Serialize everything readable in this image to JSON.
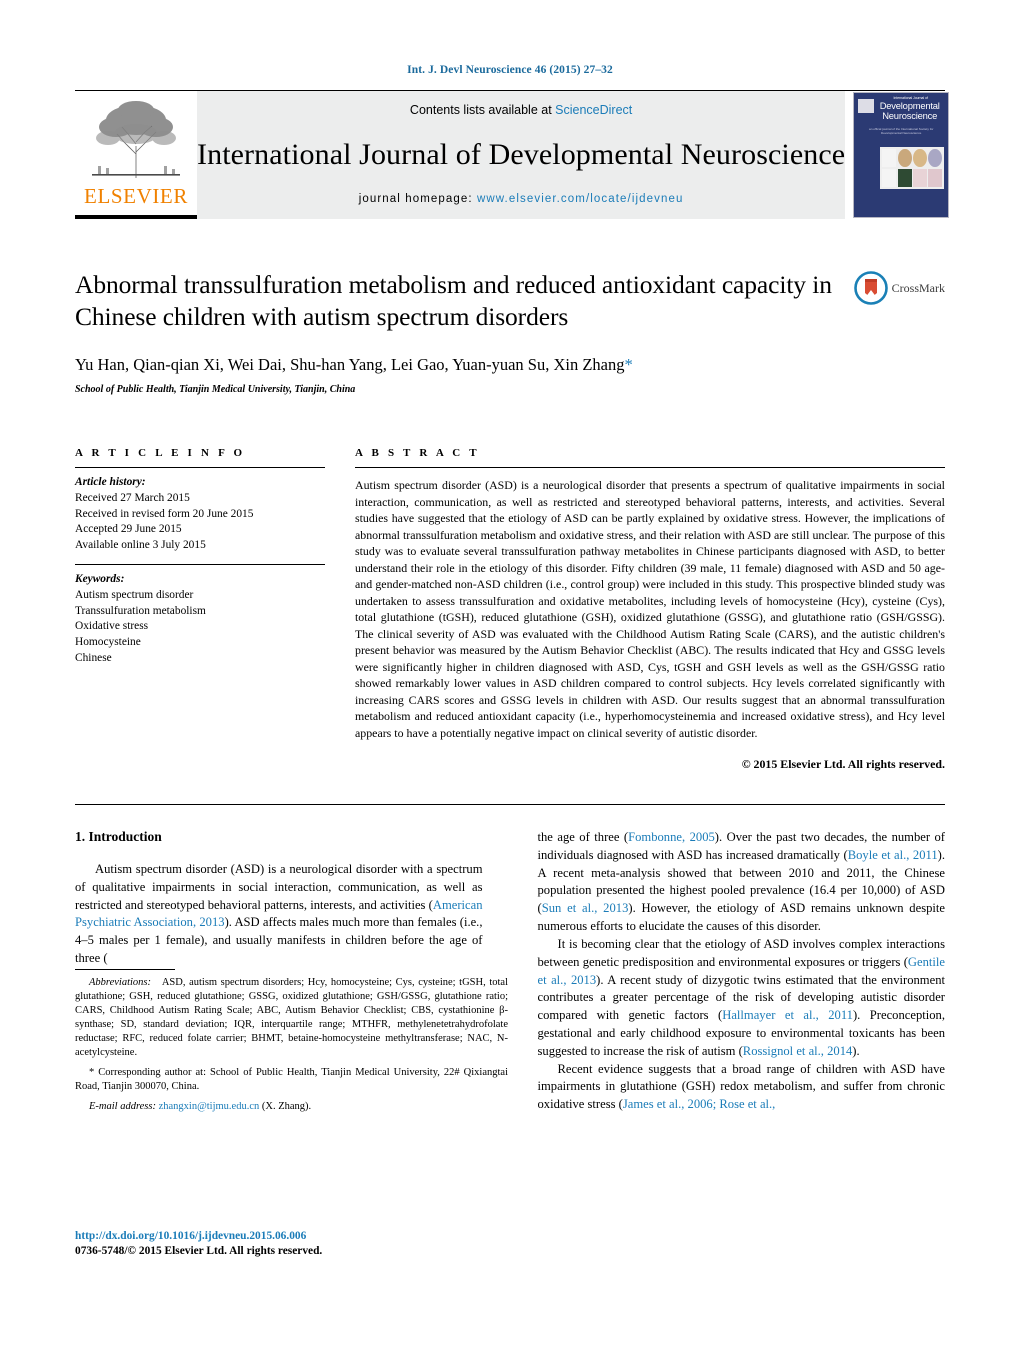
{
  "running_head": "Int. J. Devl Neuroscience 46 (2015) 27–32",
  "masthead": {
    "publisher": "ELSEVIER",
    "contents_prefix": "Contents lists available at ",
    "contents_link": "ScienceDirect",
    "journal_title": "International Journal of Developmental Neuroscience",
    "homepage_prefix": "journal homepage: ",
    "homepage_url": "www.elsevier.com/locate/ijdevneu",
    "cover": {
      "line1": "International Journal of",
      "line2": "Developmental",
      "line3": "Neuroscience",
      "tagline": "an offical journal of the International Society for Developmental Neuroscience"
    }
  },
  "article": {
    "title": "Abnormal transsulfuration metabolism and reduced antioxidant capacity in Chinese children with autism spectrum disorders",
    "authors": "Yu Han, Qian-qian Xi, Wei Dai, Shu-han Yang, Lei Gao, Yuan-yuan Su, Xin Zhang",
    "corresponding_marker": "*",
    "affiliation": "School of Public Health, Tianjin Medical University, Tianjin, China",
    "crossmark_label": "CrossMark"
  },
  "article_info": {
    "heading": "A R T I C L E   I N F O",
    "history_label": "Article history:",
    "history": [
      "Received 27 March 2015",
      "Received in revised form 20 June 2015",
      "Accepted 29 June 2015",
      "Available online 3 July 2015"
    ],
    "keywords_label": "Keywords:",
    "keywords": [
      "Autism spectrum disorder",
      "Transsulfuration metabolism",
      "Oxidative stress",
      "Homocysteine",
      "Chinese"
    ]
  },
  "abstract": {
    "heading": "A B S T R A C T",
    "text": "Autism spectrum disorder (ASD) is a neurological disorder that presents a spectrum of qualitative impairments in social interaction, communication, as well as restricted and stereotyped behavioral patterns, interests, and activities. Several studies have suggested that the etiology of ASD can be partly explained by oxidative stress. However, the implications of abnormal transsulfuration metabolism and oxidative stress, and their relation with ASD are still unclear. The purpose of this study was to evaluate several transsulfuration pathway metabolites in Chinese participants diagnosed with ASD, to better understand their role in the etiology of this disorder. Fifty children (39 male, 11 female) diagnosed with ASD and 50 age- and gender-matched non-ASD children (i.e., control group) were included in this study. This prospective blinded study was undertaken to assess transsulfuration and oxidative metabolites, including levels of homocysteine (Hcy), cysteine (Cys), total glutathione (tGSH), reduced glutathione (GSH), oxidized glutathione (GSSG), and glutathione ratio (GSH/GSSG). The clinical severity of ASD was evaluated with the Childhood Autism Rating Scale (CARS), and the autistic children's present behavior was measured by the Autism Behavior Checklist (ABC). The results indicated that Hcy and GSSG levels were significantly higher in children diagnosed with ASD, Cys, tGSH and GSH levels as well as the GSH/GSSG ratio showed remarkably lower values in ASD children compared to control subjects. Hcy levels correlated significantly with increasing CARS scores and GSSG levels in children with ASD. Our results suggest that an abnormal transsulfuration metabolism and reduced antioxidant capacity (i.e., hyperhomocysteinemia and increased oxidative stress), and Hcy level appears to have a potentially negative impact on clinical severity of autistic disorder.",
    "copyright": "© 2015 Elsevier Ltd. All rights reserved."
  },
  "introduction": {
    "heading": "1.  Introduction",
    "para1_a": "Autism spectrum disorder (ASD) is a neurological disorder with a spectrum of qualitative impairments in social interaction, communication, as well as restricted and stereotyped behavioral patterns, interests, and activities (",
    "para1_ref1": "American Psychiatric Association, 2013",
    "para1_b": "). ASD affects males much more than females (i.e., 4–5 males per 1 female), and usually manifests in children before the age of three (",
    "para1_ref2": "Fombonne, 2005",
    "para1_c": "). Over the past two decades, the number of individuals diagnosed with ASD has increased dramatically (",
    "para1_ref3": "Boyle et al., 2011",
    "para1_d": "). A recent meta-analysis showed that between 2010 and 2011, the Chinese population presented the highest pooled prevalence (16.4 per 10,000) of ASD (",
    "para1_ref4": "Sun et al., 2013",
    "para1_e": "). However, the etiology of ASD remains unknown despite numerous efforts to elucidate the causes of this disorder.",
    "para2_a": "It is becoming clear that the etiology of ASD involves complex interactions between genetic predisposition and environmental exposures or triggers (",
    "para2_ref1": "Gentile et al., 2013",
    "para2_b": "). A recent study of dizygotic twins estimated that the environment contributes a greater percentage of the risk of developing autistic disorder compared with genetic factors (",
    "para2_ref2": "Hallmayer et al., 2011",
    "para2_c": "). Preconception, gestational and early childhood exposure to environmental toxicants has been suggested to increase the risk of autism (",
    "para2_ref3": "Rossignol et al., 2014",
    "para2_d": ").",
    "para3_a": "Recent evidence suggests that a broad range of children with ASD have impairments in glutathione (GSH) redox metabolism, and suffer from chronic oxidative stress (",
    "para3_ref1": "James et al., 2006; Rose et al.,",
    "para3_b": ""
  },
  "footnotes": {
    "abbrev_label": "Abbreviations:",
    "abbrev_text": "ASD, autism spectrum disorders; Hcy, homocysteine; Cys, cysteine; tGSH, total glutathione; GSH, reduced glutathione; GSSG, oxidized glutathione; GSH/GSSG, glutathione ratio; CARS, Childhood Autism Rating Scale; ABC, Autism Behavior Checklist; CBS, cystathionine β-synthase; SD, standard deviation; IQR, interquartile range; MTHFR, methylenetetrahydrofolate reductase; RFC, reduced folate carrier; BHMT, betaine-homocysteine methyltransferase; NAC, N-acetylcysteine.",
    "corresponding_marker": "*",
    "corresponding_text": "Corresponding author at: School of Public Health, Tianjin Medical University, 22# Qixiangtai Road, Tianjin 300070, China.",
    "email_label": "E-mail address:",
    "email_value": "zhangxin@tijmu.edu.cn",
    "email_suffix": "(X. Zhang)."
  },
  "page_footer": {
    "doi": "http://dx.doi.org/10.1016/j.ijdevneu.2015.06.006",
    "issn_line": "0736-5748/© 2015 Elsevier Ltd. All rights reserved."
  },
  "colors": {
    "link": "#1b7cb8",
    "running_head": "#1b6a9c",
    "elsevier_orange": "#f08100",
    "masthead_bg": "#eceded",
    "cover_bg": "#2b3a73"
  }
}
